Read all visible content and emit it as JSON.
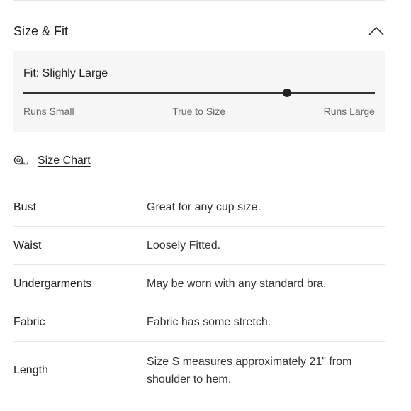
{
  "section": {
    "title": "Size & Fit",
    "expanded": true
  },
  "fit": {
    "label": "Fit: Slighly Large",
    "scale": [
      "Runs Small",
      "True to Size",
      "Runs Large"
    ],
    "position": 0.75
  },
  "size_chart": {
    "label": "Size Chart",
    "icon": "measuring-tape-icon"
  },
  "details": [
    {
      "label": "Bust",
      "value": "Great for any cup size."
    },
    {
      "label": "Waist",
      "value": "Loosely Fitted."
    },
    {
      "label": "Undergarments",
      "value": "May be worn with any standard bra."
    },
    {
      "label": "Fabric",
      "value": "Fabric has some stretch."
    },
    {
      "label": "Length",
      "value": "Size S measures approximately 21\" from shoulder to hem."
    }
  ]
}
